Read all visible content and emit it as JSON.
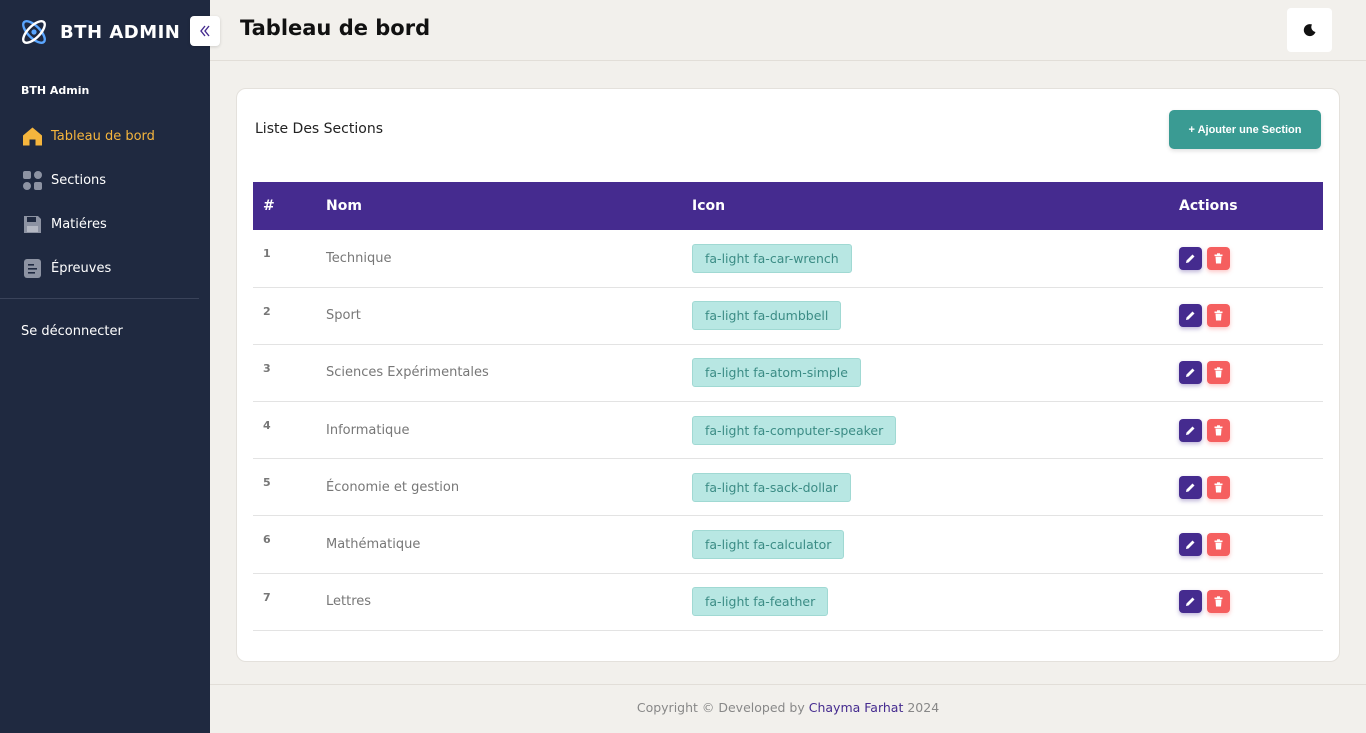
{
  "brand": {
    "name": "BTH ADMIN"
  },
  "sidebar": {
    "heading": "BTH Admin",
    "items": [
      {
        "label": "Tableau de bord",
        "icon": "home-icon",
        "active": true
      },
      {
        "label": "Sections",
        "icon": "grid-icon",
        "active": false
      },
      {
        "label": "Matiéres",
        "icon": "floppy-icon",
        "active": false
      },
      {
        "label": "Épreuves",
        "icon": "list-icon",
        "active": false
      }
    ],
    "logout": "Se déconnecter"
  },
  "header": {
    "title": "Tableau de bord"
  },
  "card": {
    "title": "Liste Des Sections",
    "add_button": "+ Ajouter une Section",
    "columns": [
      "#",
      "Nom",
      "Icon",
      "Actions"
    ],
    "rows": [
      {
        "id": "1",
        "name": "Technique",
        "icon": "fa-light fa-car-wrench"
      },
      {
        "id": "2",
        "name": "Sport",
        "icon": "fa-light fa-dumbbell"
      },
      {
        "id": "3",
        "name": "Sciences Expérimentales",
        "icon": "fa-light fa-atom-simple"
      },
      {
        "id": "4",
        "name": "Informatique",
        "icon": "fa-light fa-computer-speaker"
      },
      {
        "id": "5",
        "name": "Économie et gestion",
        "icon": "fa-light fa-sack-dollar"
      },
      {
        "id": "6",
        "name": "Mathématique",
        "icon": "fa-light fa-calculator"
      },
      {
        "id": "7",
        "name": "Lettres",
        "icon": "fa-light fa-feather"
      }
    ]
  },
  "footer": {
    "prefix": "Copyright © Developed by ",
    "author": "Chayma Farhat",
    "year": " 2024"
  },
  "colors": {
    "sidebar_bg": "#1f2940",
    "accent_active": "#f5b53d",
    "table_header": "#452b8f",
    "add_button": "#3a9b93",
    "tag_bg": "#b8e7e3",
    "delete": "#f55f5f"
  }
}
